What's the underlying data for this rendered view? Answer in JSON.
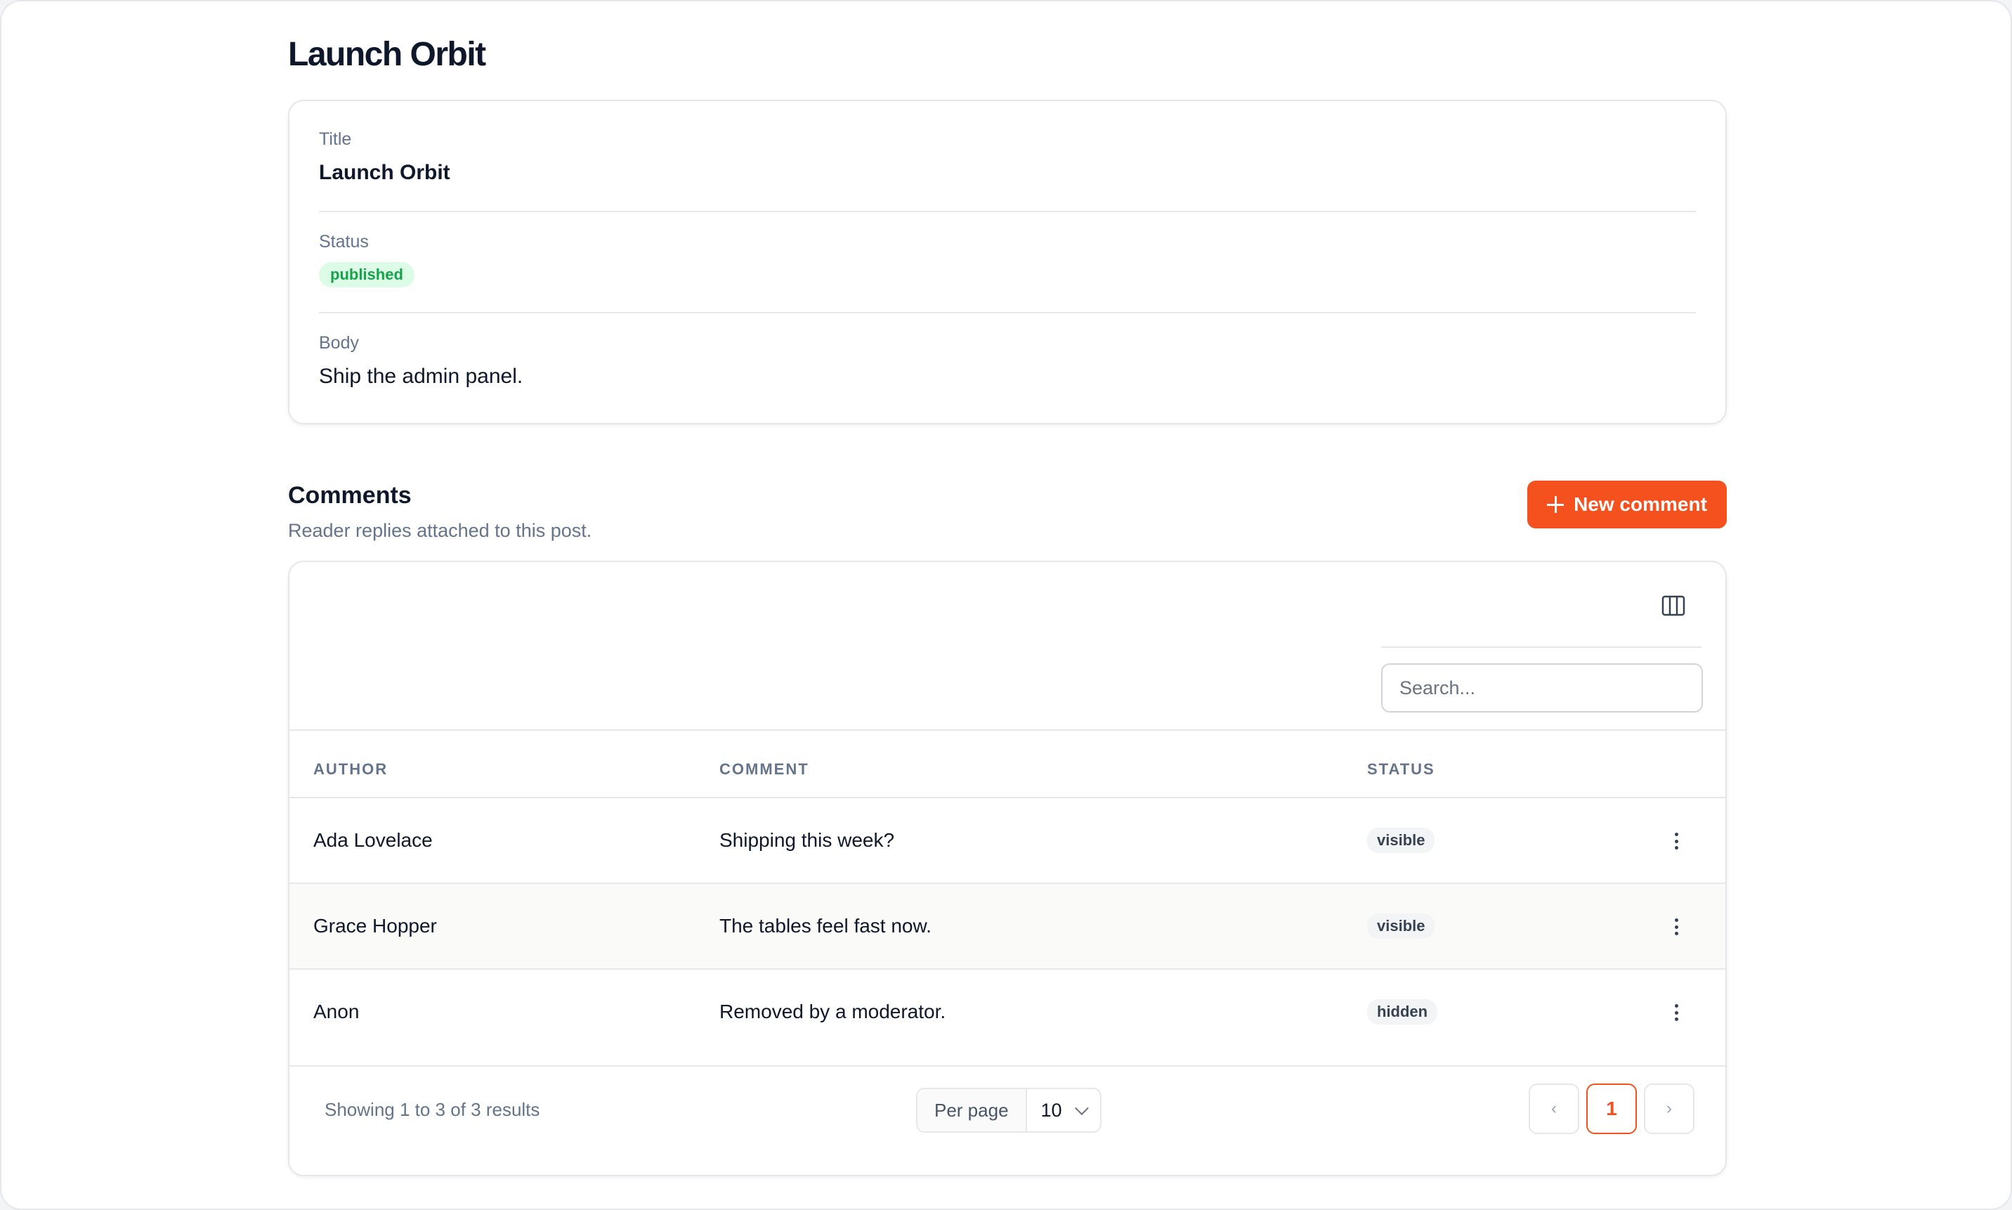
{
  "page": {
    "title": "Launch Orbit"
  },
  "record": {
    "title_label": "Title",
    "title_value": "Launch Orbit",
    "status_label": "Status",
    "status_value": "published",
    "body_label": "Body",
    "body_value": "Ship the admin panel."
  },
  "comments": {
    "heading": "Comments",
    "subheading": "Reader replies attached to this post.",
    "new_button_label": "New comment",
    "search_placeholder": "Search...",
    "columns": {
      "author": "Author",
      "comment": "Comment",
      "status": "Status"
    },
    "rows": [
      {
        "author": "Ada Lovelace",
        "comment": "Shipping this week?",
        "status": "visible"
      },
      {
        "author": "Grace Hopper",
        "comment": "The tables feel fast now.",
        "status": "visible"
      },
      {
        "author": "Anon",
        "comment": "Removed by a moderator.",
        "status": "hidden"
      }
    ],
    "footer": {
      "showing": "Showing 1 to 3 of 3 results",
      "per_page_label": "Per page",
      "per_page_value": "10",
      "prev_label": "‹",
      "current_page": "1",
      "next_label": "›"
    }
  },
  "colors": {
    "accent": "#f4511e",
    "published": "#16a34a"
  },
  "icons": {
    "new_button": "plus-icon",
    "columns_toggle": "columns-icon",
    "row_actions": "kebab-icon"
  }
}
